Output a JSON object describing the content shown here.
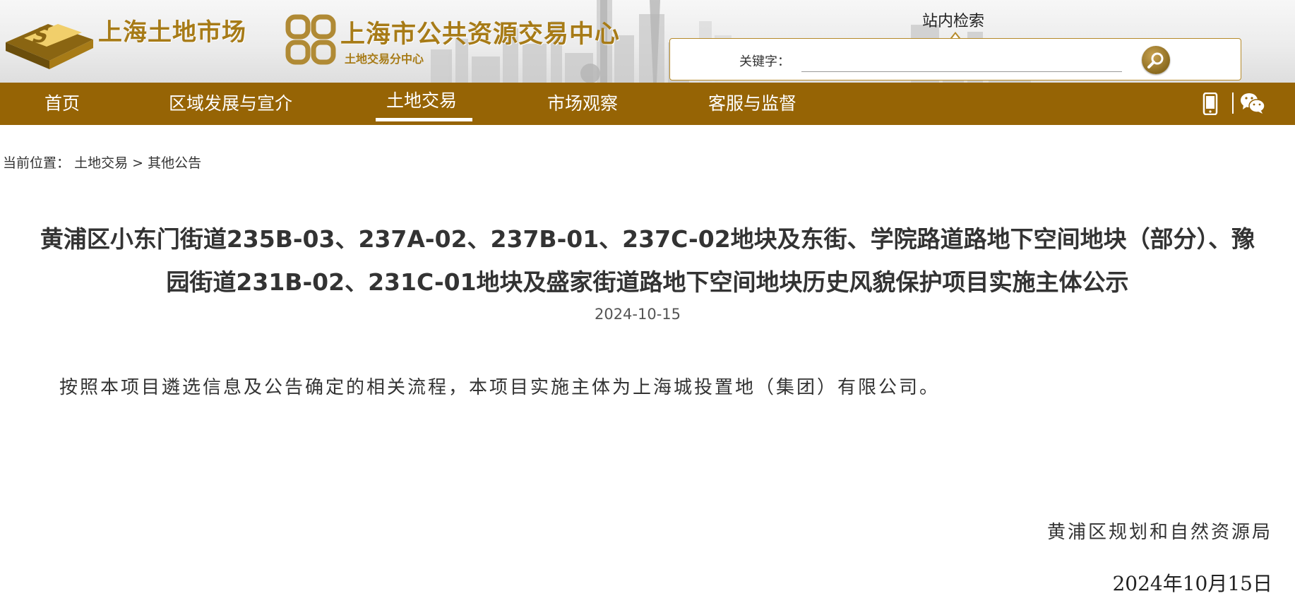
{
  "header": {
    "logo_text": "上海土地市场",
    "center_title": "上海市公共资源交易中心",
    "center_subtitle": "土地交易分中心"
  },
  "search": {
    "title": "站内检索",
    "label": "关键字：",
    "input_value": "",
    "button_icon": "search-icon"
  },
  "nav": {
    "items": [
      "首页",
      "区域发展与宣介",
      "土地交易",
      "市场观察",
      "客服与监督"
    ],
    "active_index": 2,
    "right_icons": [
      "mobile-phone-icon",
      "wechat-icon"
    ]
  },
  "breadcrumb": {
    "prefix": "当前位置：",
    "items": [
      "土地交易",
      "其他公告"
    ],
    "separator": ">"
  },
  "article": {
    "title_line1": "黄浦区小东门街道235B-03、237A-02、237B-01、237C-02地块及东街、学院路道路地下空间地块（部分）、豫",
    "title_line2": "园街道231B-02、231C-01地块及盛家街道路地下空间地块历史风貌保护项目实施主体公示",
    "date": "2024-10-15",
    "body": "按照本项目遴选信息及公告确定的相关流程，本项目实施主体为上海城投置地（集团）有限公司。",
    "signature": "黄浦区规划和自然资源局",
    "sign_date": "2024年10月15日"
  },
  "colors": {
    "nav_bg": "#966405",
    "brand_gold": "#a77b17"
  }
}
